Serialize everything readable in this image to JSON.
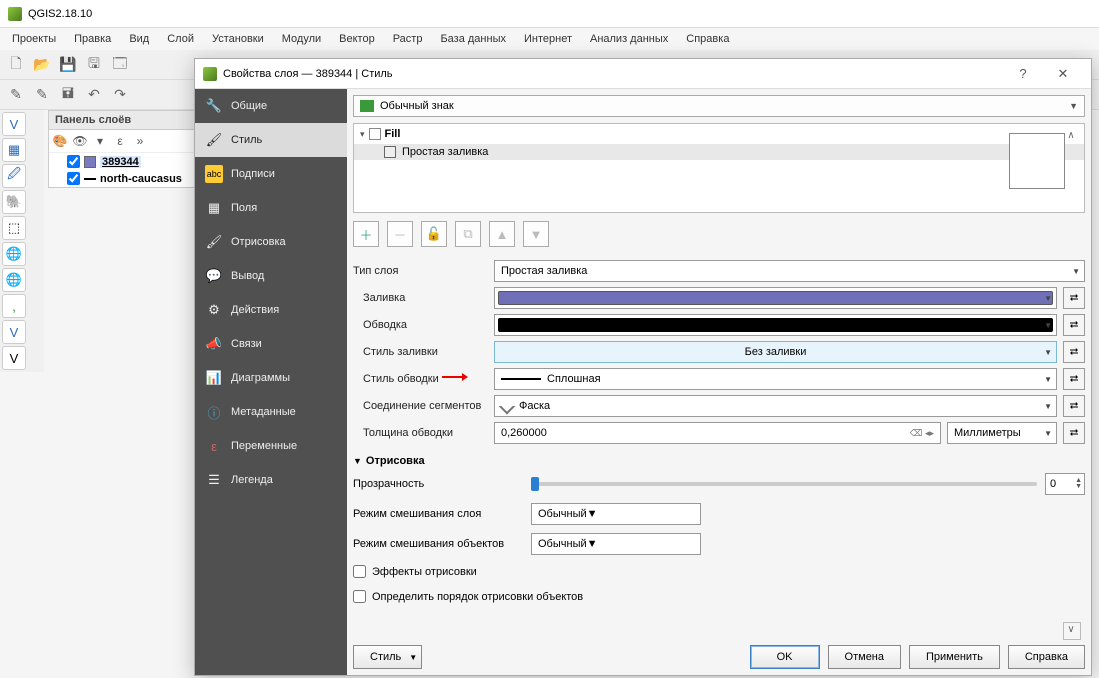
{
  "app": {
    "title": "QGIS2.18.10"
  },
  "menu": [
    "Проекты",
    "Правка",
    "Вид",
    "Слой",
    "Установки",
    "Модули",
    "Вектор",
    "Растр",
    "База данных",
    "Интернет",
    "Анализ данных",
    "Справка"
  ],
  "layers_panel": {
    "title": "Панель слоёв",
    "items": [
      {
        "name": "389344",
        "selected": true,
        "type": "polygon"
      },
      {
        "name": "north-caucasus",
        "selected": false,
        "type": "line"
      }
    ]
  },
  "dialog": {
    "title": "Свойства слоя — 389344 | Стиль",
    "sidebar": [
      "Общие",
      "Стиль",
      "Подписи",
      "Поля",
      "Отрисовка",
      "Вывод",
      "Действия",
      "Связи",
      "Диаграммы",
      "Метаданные",
      "Переменные",
      "Легенда"
    ],
    "sidebar_selected": 1,
    "symbol_type": "Обычный знак",
    "layer_tree": {
      "root": "Fill",
      "child": "Простая заливка"
    },
    "form": {
      "layer_type_label": "Тип слоя",
      "layer_type_value": "Простая заливка",
      "fill_label": "Заливка",
      "stroke_label": "Обводка",
      "fill_style_label": "Стиль заливки",
      "fill_style_value": "Без заливки",
      "stroke_style_label": "Стиль обводки",
      "stroke_style_value": "Сплошная",
      "join_label": "Соединение сегментов",
      "join_value": "Фаска",
      "width_label": "Толщина обводки",
      "width_value": "0,260000",
      "width_unit": "Миллиметры"
    },
    "render": {
      "section": "Отрисовка",
      "transparency_label": "Прозрачность",
      "transparency_value": "0",
      "layer_blend_label": "Режим смешивания слоя",
      "layer_blend_value": "Обычный",
      "feature_blend_label": "Режим смешивания объектов",
      "feature_blend_value": "Обычный",
      "draw_effects": "Эффекты отрисовки",
      "draw_order": "Определить порядок отрисовки объектов"
    },
    "footer": {
      "style": "Стиль",
      "ok": "OK",
      "cancel": "Отмена",
      "apply": "Применить",
      "help": "Справка"
    }
  }
}
